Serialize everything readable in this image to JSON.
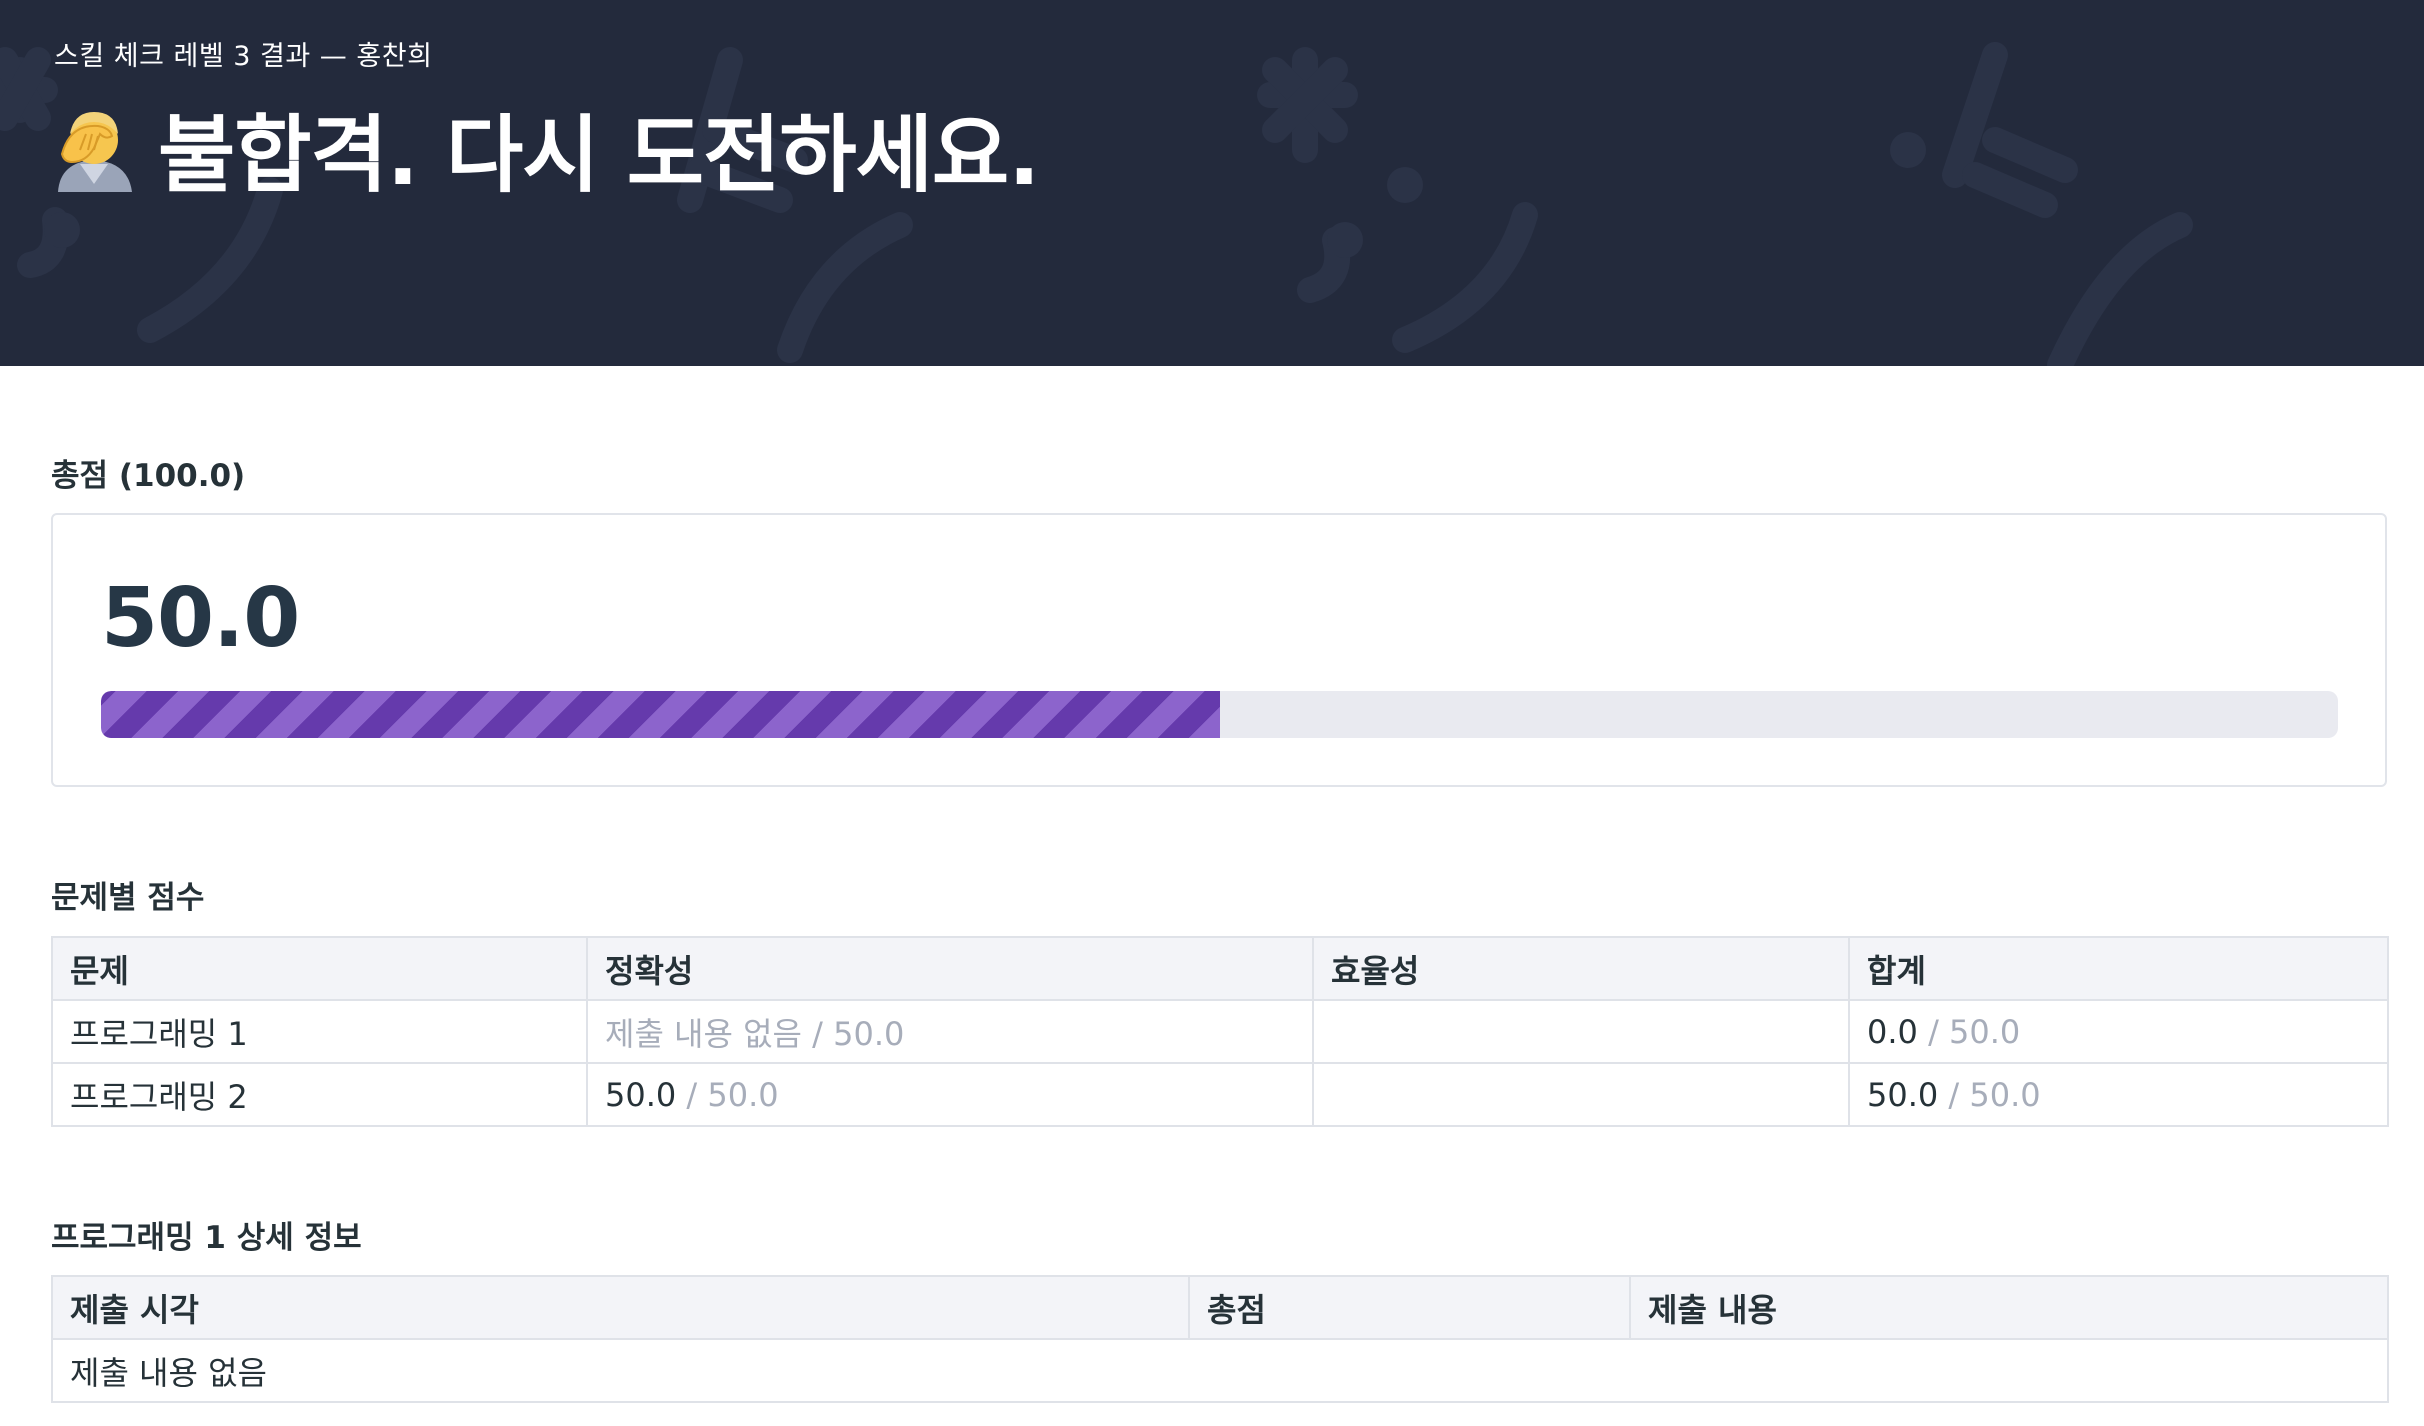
{
  "header": {
    "subtitle": "스킬 체크 레벨 3 결과 — 홍찬희",
    "title": "불합격. 다시 도전하세요.",
    "icon": "facepalm-icon",
    "background_color": "#232a3c"
  },
  "total": {
    "heading": "총점 (100.0)",
    "score": "50.0",
    "progress_percent": 50,
    "bar_color": "#6a3fb3"
  },
  "problems": {
    "heading": "문제별 점수",
    "columns": [
      "문제",
      "정확성",
      "효율성",
      "합계"
    ],
    "rows": [
      {
        "name": "프로그래밍 1",
        "accuracy_value": "제출 내용 없음",
        "accuracy_max": " / 50.0",
        "efficiency": "",
        "total_value": "0.0",
        "total_max": " / 50.0"
      },
      {
        "name": "프로그래밍 2",
        "accuracy_value": "50.0",
        "accuracy_max": " / 50.0",
        "efficiency": "",
        "total_value": "50.0",
        "total_max": " / 50.0"
      }
    ]
  },
  "detail": {
    "heading": "프로그래밍 1 상세 정보",
    "columns": [
      "제출 시각",
      "총점",
      "제출 내용"
    ],
    "empty_text": "제출 내용 없음"
  }
}
